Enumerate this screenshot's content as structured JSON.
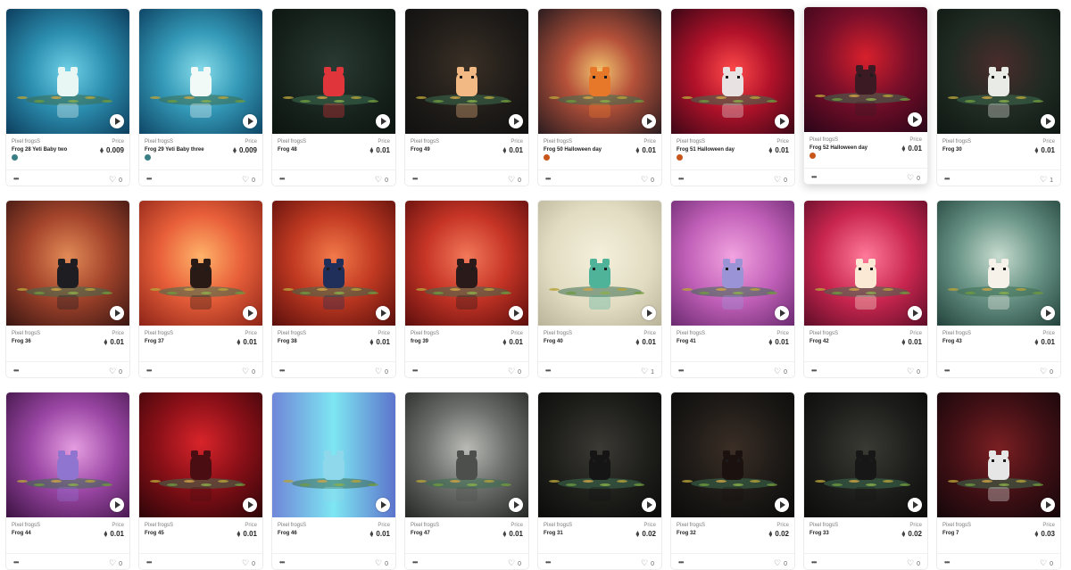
{
  "cards": [
    {
      "collection": "Pixel frogsS",
      "name": "Frog 28 Yeti Baby two",
      "price_label": "Price",
      "price": "0.009",
      "likes": "0",
      "badge": "#3b7f86",
      "bg": "radial-gradient(circle at 50% 50%, #6fd0e6 0%, #2c8fb0 45%, #0d3e5e 100%)",
      "frog": "#e8f6f4",
      "eyes": false
    },
    {
      "collection": "Pixel frogsS",
      "name": "Frog 29 Yeti Baby three",
      "price_label": "Price",
      "price": "0.009",
      "likes": "0",
      "badge": "#3b7f86",
      "bg": "radial-gradient(circle at 50% 50%, #86dbe9 0%, #349ab8 45%, #0f4666 100%)",
      "frog": "#f2faf8",
      "eyes": false
    },
    {
      "collection": "Pixel frogsS",
      "name": "Frog 48",
      "price_label": "Price",
      "price": "0.01",
      "likes": "0",
      "badge": null,
      "bg": "radial-gradient(circle at 50% 45%, #2a3a33 0%, #16211c 60%, #0c1410 100%)",
      "frog": "#e0353a",
      "eyes": false
    },
    {
      "collection": "Pixel frogsS",
      "name": "Frog 49",
      "price_label": "Price",
      "price": "0.01",
      "likes": "0",
      "badge": null,
      "bg": "radial-gradient(circle at 50% 45%, #3a3026 0%, #1d1a17 60%, #111 100%)",
      "frog": "#f3b985",
      "eyes": true
    },
    {
      "collection": "Pixel frogsS",
      "name": "Frog 50 Halloween day",
      "price_label": "Price",
      "price": "0.01",
      "likes": "0",
      "badge": "#c8561b",
      "bg": "radial-gradient(circle at 50% 50%, #f2c26e 0%, #b5513a 40%, #2a1c20 100%)",
      "frog": "#e7782a",
      "eyes": true
    },
    {
      "collection": "Pixel frogsS",
      "name": "Frog 51 Halloween day",
      "price_label": "Price",
      "price": "0.01",
      "likes": "0",
      "badge": "#c8561b",
      "bg": "radial-gradient(circle at 50% 50%, #ff4a4a 0%, #b2122a 45%, #3c0716 100%)",
      "frog": "#e9e2e2",
      "eyes": true
    },
    {
      "collection": "Pixel frogsS",
      "name": "Frog 52 Halloween day",
      "price_label": "Price",
      "price": "0.01",
      "likes": "0",
      "badge": "#c8561b",
      "bg": "radial-gradient(circle at 50% 40%, #d8202c 0%, #7a0f2a 45%, #2a0518 100%)",
      "frog": "#3b1a24",
      "eyes": true,
      "raised": true
    },
    {
      "collection": "Pixel frogsS",
      "name": "Frog 30",
      "price_label": "Price",
      "price": "0.01",
      "likes": "1",
      "badge": null,
      "bg": "radial-gradient(circle at 50% 45%, #4a2c2c 0%, #1e2a22 55%, #0f1712 100%)",
      "frog": "#e9ece6",
      "eyes": true
    },
    {
      "collection": "Pixel frogsS",
      "name": "Frog 36",
      "price_label": "Price",
      "price": "0.01",
      "likes": "0",
      "badge": null,
      "bg": "radial-gradient(circle at 50% 45%, #e28b57 0%, #a5452c 45%, #3a1612 100%)",
      "frog": "#1e1e22",
      "eyes": true
    },
    {
      "collection": "Pixel frogsS",
      "name": "Frog 37",
      "price_label": "Price",
      "price": "0.01",
      "likes": "0",
      "badge": null,
      "bg": "radial-gradient(circle at 50% 45%, #ffb36a 0%, #e9603a 45%, #8d2418 100%)",
      "frog": "#2a1a16",
      "eyes": true
    },
    {
      "collection": "Pixel frogsS",
      "name": "Frog 38",
      "price_label": "Price",
      "price": "0.01",
      "likes": "0",
      "badge": null,
      "bg": "radial-gradient(circle at 50% 45%, #f27a4a 0%, #c23a22 45%, #5a0f0c 100%)",
      "frog": "#1f2f5a",
      "eyes": true
    },
    {
      "collection": "Pixel frogsS",
      "name": "frog 39",
      "price_label": "Price",
      "price": "0.01",
      "likes": "0",
      "badge": null,
      "bg": "radial-gradient(circle at 50% 45%, #f2795a 0%, #c73526 45%, #5d0e0d 100%)",
      "frog": "#2a1a1a",
      "eyes": true
    },
    {
      "collection": "Pixel frogsS",
      "name": "Frog 40",
      "price_label": "Price",
      "price": "0.01",
      "likes": "1",
      "badge": null,
      "bg": "radial-gradient(circle at 50% 45%, #f5f0dc 0%, #e2dcc2 55%, #b9b39a 100%)",
      "frog": "#4fb39a",
      "eyes": true
    },
    {
      "collection": "Pixel frogsS",
      "name": "Frog 41",
      "price_label": "Price",
      "price": "0.01",
      "likes": "0",
      "badge": null,
      "bg": "radial-gradient(circle at 50% 45%, #f2a3e0 0%, #c160b8 50%, #6b2a70 100%)",
      "frog": "#9a94d6",
      "eyes": true
    },
    {
      "collection": "Pixel frogsS",
      "name": "Frog 42",
      "price_label": "Price",
      "price": "0.01",
      "likes": "0",
      "badge": null,
      "bg": "radial-gradient(circle at 50% 45%, #ff7a9a 0%, #c9264f 50%, #5e0d28 100%)",
      "frog": "#fbe9d6",
      "eyes": true
    },
    {
      "collection": "Pixel frogsS",
      "name": "Frog 43",
      "price_label": "Price",
      "price": "0.01",
      "likes": "0",
      "badge": null,
      "bg": "radial-gradient(circle at 50% 45%, #c8dcd0 0%, #6b9688 45%, #22423b 100%)",
      "frog": "#f6f2ea",
      "eyes": true
    },
    {
      "collection": "Pixel frogsS",
      "name": "Frog 44",
      "price_label": "Price",
      "price": "0.01",
      "likes": "0",
      "badge": null,
      "bg": "radial-gradient(circle at 55% 45%, #e59de0 0%, #9b47a5 45%, #3c1242 100%)",
      "frog": "#8f74d0",
      "eyes": false
    },
    {
      "collection": "Pixel frogsS",
      "name": "Frog 45",
      "price_label": "Price",
      "price": "0.01",
      "likes": "0",
      "badge": null,
      "bg": "radial-gradient(circle at 50% 40%, #d8242a 0%, #8c1018 45%, #2d0508 100%)",
      "frog": "#4a0d12",
      "eyes": false
    },
    {
      "collection": "Pixel frogsS",
      "name": "Frog 46",
      "price_label": "Price",
      "price": "0.01",
      "likes": "0",
      "badge": null,
      "bg": "linear-gradient(90deg, #6f86d8 0%, #7ee6f2 50%, #5c74cc 100%)",
      "frog": "#8fd7ea",
      "eyes": false
    },
    {
      "collection": "Pixel frogsS",
      "name": "Frog 47",
      "price_label": "Price",
      "price": "0.01",
      "likes": "0",
      "badge": null,
      "bg": "radial-gradient(circle at 50% 45%, #b9bab6 0%, #6d6f6c 45%, #262826 100%)",
      "frog": "#4c4f4c",
      "eyes": false
    },
    {
      "collection": "Pixel frogsS",
      "name": "Frog 31",
      "price_label": "Price",
      "price": "0.02",
      "likes": "0",
      "badge": null,
      "bg": "radial-gradient(circle at 50% 45%, #3b3a34 0%, #1d1d1a 55%, #0b0b0a 100%)",
      "frog": "#151515",
      "eyes": true
    },
    {
      "collection": "Pixel frogsS",
      "name": "Frog 32",
      "price_label": "Price",
      "price": "0.02",
      "likes": "0",
      "badge": null,
      "bg": "radial-gradient(circle at 50% 45%, #3b2e26 0%, #1c1916 55%, #0b0b0a 100%)",
      "frog": "#1b1210",
      "eyes": true
    },
    {
      "collection": "Pixel frogsS",
      "name": "Frog 33",
      "price_label": "Price",
      "price": "0.02",
      "likes": "0",
      "badge": null,
      "bg": "radial-gradient(circle at 50% 45%, #3a3a34 0%, #1c1c1a 55%, #0b0b0a 100%)",
      "frog": "#171717",
      "eyes": true
    },
    {
      "collection": "Pixel frogsS",
      "name": "Frog 7",
      "price_label": "Price",
      "price": "0.03",
      "likes": "0",
      "badge": null,
      "bg": "radial-gradient(circle at 50% 45%, #7a1f22 0%, #3d0f14 55%, #14070a 100%)",
      "frog": "#e6e6e6",
      "eyes": true
    }
  ]
}
